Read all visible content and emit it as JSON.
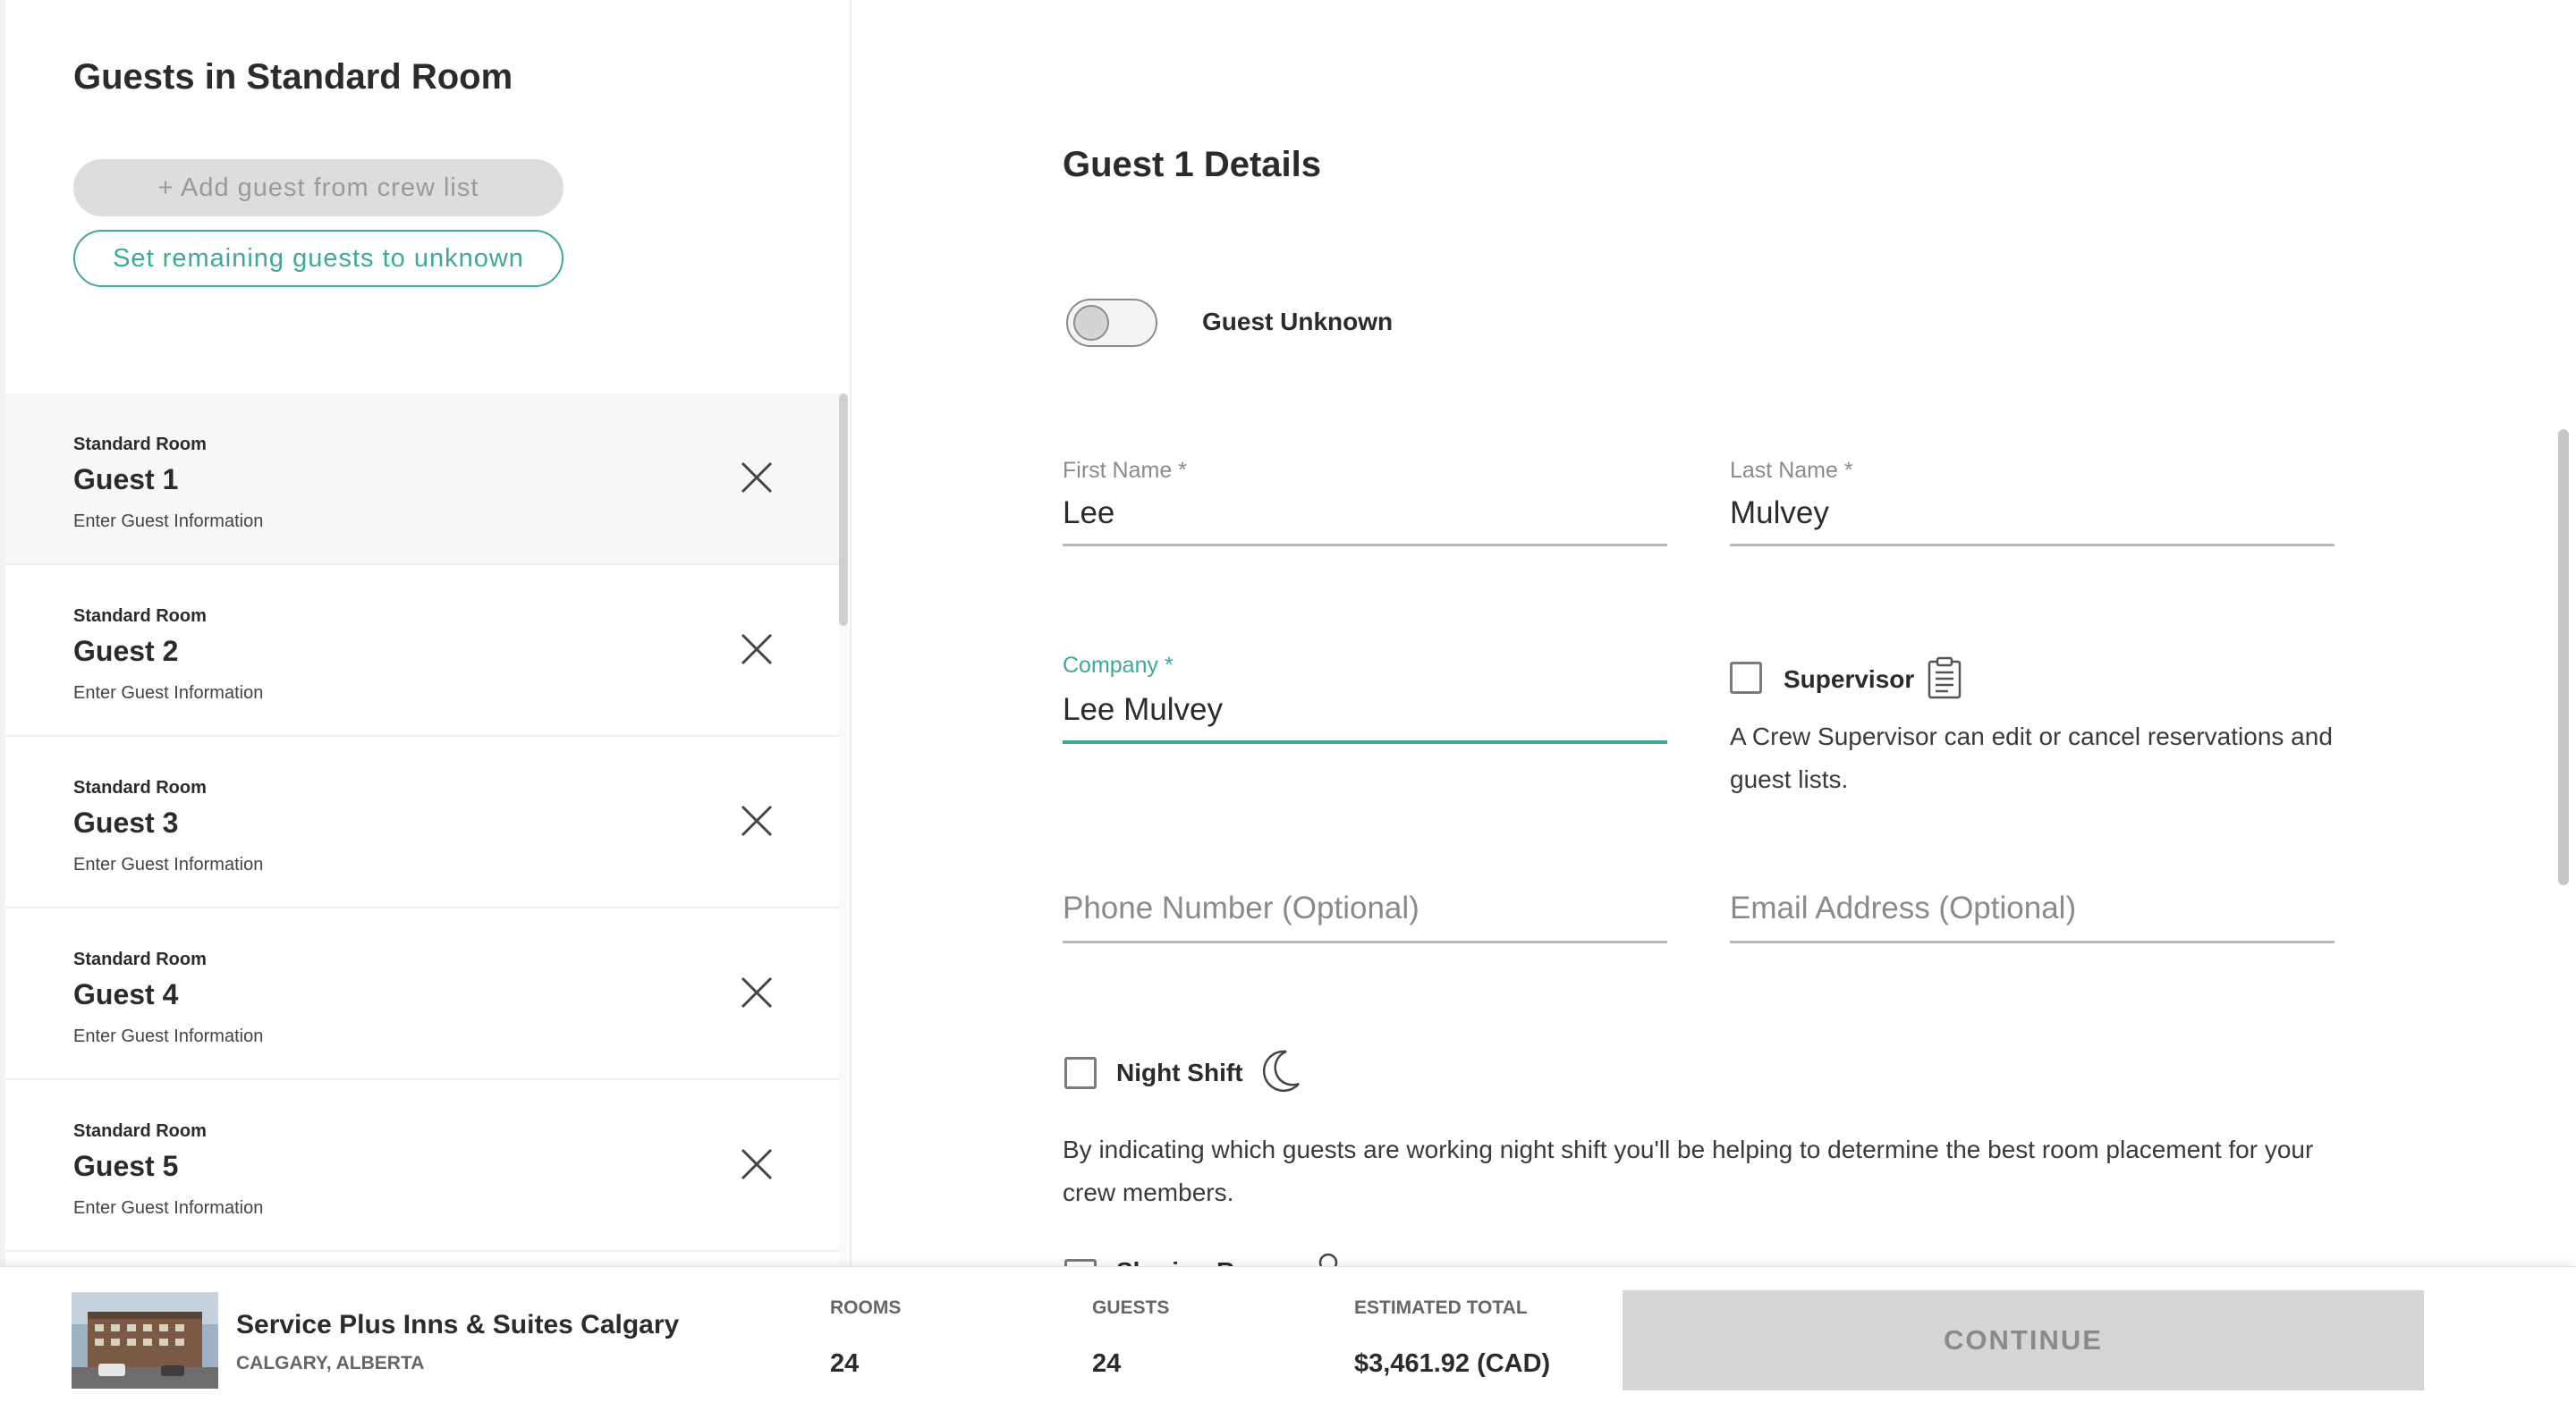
{
  "left_panel": {
    "title": "Guests in Standard Room",
    "add_guest_label": "+ Add guest from crew list",
    "set_unknown_label": "Set remaining guests to unknown",
    "guests": [
      {
        "room_type": "Standard Room",
        "name": "Guest 1",
        "subtitle": "Enter Guest Information",
        "active": true
      },
      {
        "room_type": "Standard Room",
        "name": "Guest 2",
        "subtitle": "Enter Guest Information",
        "active": false
      },
      {
        "room_type": "Standard Room",
        "name": "Guest 3",
        "subtitle": "Enter Guest Information",
        "active": false
      },
      {
        "room_type": "Standard Room",
        "name": "Guest 4",
        "subtitle": "Enter Guest Information",
        "active": false
      },
      {
        "room_type": "Standard Room",
        "name": "Guest 5",
        "subtitle": "Enter Guest Information",
        "active": false
      }
    ]
  },
  "form": {
    "title": "Guest 1 Details",
    "guest_unknown_label": "Guest Unknown",
    "guest_unknown_on": false,
    "first_name": {
      "label": "First Name *",
      "value": "Lee"
    },
    "last_name": {
      "label": "Last Name *",
      "value": "Mulvey"
    },
    "company": {
      "label": "Company *",
      "value": "Lee Mulvey"
    },
    "phone": {
      "placeholder": "Phone Number (Optional)"
    },
    "email": {
      "placeholder": "Email Address (Optional)"
    },
    "supervisor": {
      "label": "Supervisor",
      "checked": false,
      "help": "A Crew Supervisor can edit or cancel reservations and guest lists."
    },
    "night_shift": {
      "label": "Night Shift",
      "checked": false,
      "help": "By indicating which guests are working night shift you'll be helping to determine the best room placement for your crew members."
    },
    "partial_next_label": "Sharing Room"
  },
  "footer": {
    "hotel_name": "Service Plus Inns & Suites Calgary",
    "hotel_location": "CALGARY, ALBERTA",
    "rooms_label": "ROOMS",
    "rooms_value": "24",
    "guests_label": "GUESTS",
    "guests_value": "24",
    "total_label": "ESTIMATED TOTAL",
    "total_value": "$3,461.92 (CAD)",
    "continue_label": "CONTINUE"
  },
  "colors": {
    "accent": "#3ea89a",
    "disabled_bg": "#d5d5d5",
    "text": "#2b2b2b"
  }
}
